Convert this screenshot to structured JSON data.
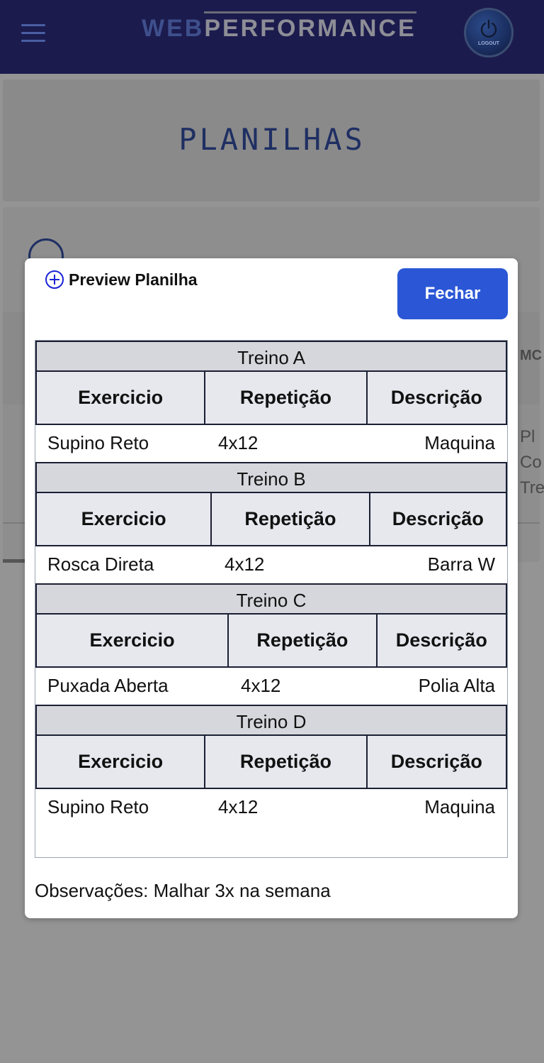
{
  "app": {
    "brand_web": "WEB",
    "brand_performance": "PERFORMANCE",
    "logout_label": "LOGOUT"
  },
  "page": {
    "title": "PLANILHAS",
    "peek_header": "MC",
    "peek_lines": [
      "Pl",
      "Co",
      "Tre"
    ]
  },
  "modal": {
    "title": "Preview Planilha",
    "close_label": "Fechar",
    "columns": [
      "Exercicio",
      "Repetição",
      "Descrição"
    ],
    "treinos": [
      {
        "name": "Treino A",
        "exercicio": "Supino Reto",
        "repeticao": "4x12",
        "descricao": "Maquina"
      },
      {
        "name": "Treino B",
        "exercicio": "Rosca Direta",
        "repeticao": "4x12",
        "descricao": "Barra W"
      },
      {
        "name": "Treino C",
        "exercicio": "Puxada Aberta",
        "repeticao": "4x12",
        "descricao": "Polia Alta"
      },
      {
        "name": "Treino D",
        "exercicio": "Supino Reto",
        "repeticao": "4x12",
        "descricao": "Maquina"
      }
    ],
    "observacoes": "Observações: Malhar 3x na semana"
  },
  "colors": {
    "header_bg": "#1c1b4e",
    "accent_button": "#2b57d6",
    "overlay": "#949494"
  },
  "icons": [
    "hamburger-menu-icon",
    "power-icon",
    "plus-circle-icon"
  ]
}
